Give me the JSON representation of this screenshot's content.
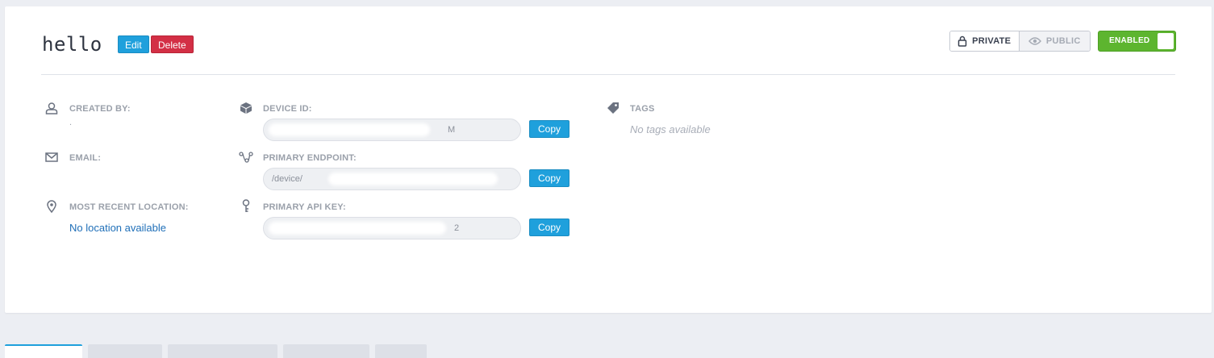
{
  "device": {
    "name": "hello",
    "edit_label": "Edit",
    "delete_label": "Delete"
  },
  "visibility": {
    "private_label": "PRIVATE",
    "public_label": "PUBLIC",
    "selected": "private"
  },
  "status_toggle": {
    "label": "ENABLED",
    "on": true,
    "color": "#5db52f"
  },
  "details": {
    "created_by": {
      "label": "CREATED BY:",
      "value": "."
    },
    "email": {
      "label": "EMAIL:"
    },
    "location": {
      "label": "MOST RECENT LOCATION:",
      "value": "No location available"
    },
    "device_id": {
      "label": "DEVICE ID:",
      "value_tail": "M",
      "copy_label": "Copy"
    },
    "primary_endpoint": {
      "label": "PRIMARY ENDPOINT:",
      "value_head": "/device/",
      "copy_label": "Copy"
    },
    "primary_api_key": {
      "label": "PRIMARY API KEY:",
      "value_tail": "2",
      "copy_label": "Copy"
    },
    "tags": {
      "label": "TAGS",
      "value": "No tags available"
    }
  },
  "colors": {
    "accent": "#1fa0dc",
    "danger": "#d32f45",
    "success": "#5db52f",
    "link": "#1f6fb8"
  },
  "tabs": [
    "",
    "",
    "",
    "",
    ""
  ]
}
